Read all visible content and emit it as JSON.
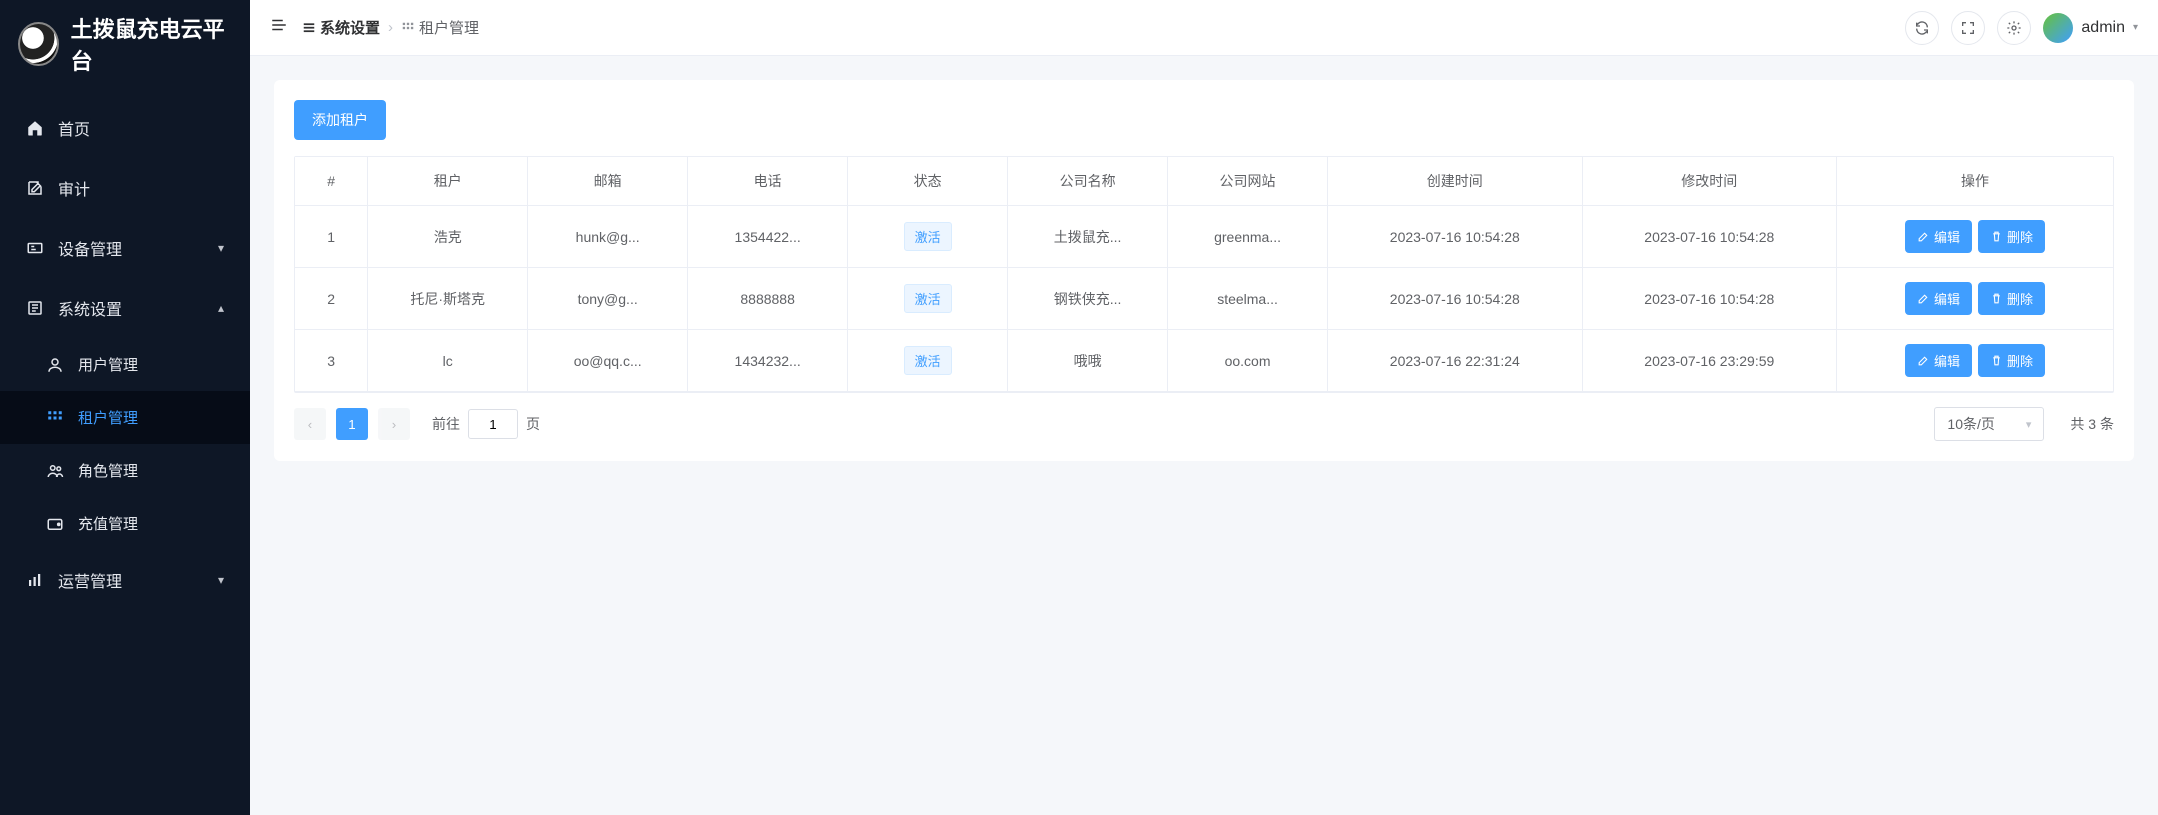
{
  "app": {
    "title": "土拨鼠充电云平台"
  },
  "sidebar": {
    "items": [
      {
        "label": "首页",
        "icon": "home"
      },
      {
        "label": "审计",
        "icon": "edit-doc"
      },
      {
        "label": "设备管理",
        "icon": "device",
        "expandable": true
      },
      {
        "label": "系统设置",
        "icon": "settings-box",
        "expanded": true,
        "children": [
          {
            "label": "用户管理",
            "icon": "user"
          },
          {
            "label": "租户管理",
            "icon": "grid",
            "active": true
          },
          {
            "label": "角色管理",
            "icon": "users"
          },
          {
            "label": "充值管理",
            "icon": "wallet"
          }
        ]
      },
      {
        "label": "运营管理",
        "icon": "chart",
        "expandable": true
      }
    ]
  },
  "header": {
    "breadcrumb": [
      {
        "icon": "list-icon",
        "label": "系统设置"
      },
      {
        "icon": "grid-icon",
        "label": "租户管理"
      }
    ],
    "user": "admin"
  },
  "content": {
    "add_button": "添加租户",
    "columns": [
      "#",
      "租户",
      "邮箱",
      "电话",
      "状态",
      "公司名称",
      "公司网站",
      "创建时间",
      "修改时间",
      "操作"
    ],
    "status_label": "激活",
    "edit_label": "编辑",
    "delete_label": "删除",
    "rows": [
      {
        "id": "1",
        "tenant": "浩克",
        "email": "hunk@g...",
        "phone": "1354422...",
        "company": "土拨鼠充...",
        "website": "greenma...",
        "created": "2023-07-16 10:54:28",
        "updated": "2023-07-16 10:54:28"
      },
      {
        "id": "2",
        "tenant": "托尼·斯塔克",
        "email": "tony@g...",
        "phone": "8888888",
        "company": "钢铁侠充...",
        "website": "steelma...",
        "created": "2023-07-16 10:54:28",
        "updated": "2023-07-16 10:54:28"
      },
      {
        "id": "3",
        "tenant": "lc",
        "email": "oo@qq.c...",
        "phone": "1434232...",
        "company": "哦哦",
        "website": "oo.com",
        "created": "2023-07-16 22:31:24",
        "updated": "2023-07-16 23:29:59"
      }
    ],
    "pager": {
      "current": "1",
      "jump_prefix": "前往",
      "jump_value": "1",
      "jump_suffix": "页",
      "size_label": "10条/页",
      "total_label": "共 3 条"
    }
  }
}
